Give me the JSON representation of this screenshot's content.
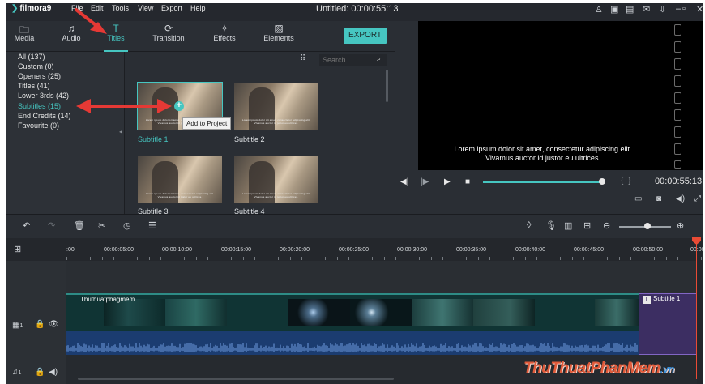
{
  "app": {
    "logo_text": "filmora9",
    "window_title": "Untitled: 00:00:55:13",
    "menu": [
      "File",
      "Edit",
      "Tools",
      "View",
      "Export",
      "Help"
    ],
    "window_icons": [
      "user-icon",
      "save-icon",
      "cart-icon",
      "mail-icon",
      "download-icon",
      "minimize-icon",
      "maximize-icon",
      "close-icon"
    ]
  },
  "tabs": [
    {
      "label": "Media",
      "icon": "folder-icon"
    },
    {
      "label": "Audio",
      "icon": "music-note-icon"
    },
    {
      "label": "Titles",
      "icon": "text-icon"
    },
    {
      "label": "Transition",
      "icon": "transition-icon"
    },
    {
      "label": "Effects",
      "icon": "effects-icon"
    },
    {
      "label": "Elements",
      "icon": "elements-icon"
    }
  ],
  "active_tab": "Titles",
  "export_label": "EXPORT",
  "categories": [
    "All (137)",
    "Custom (0)",
    "Openers (25)",
    "Titles (41)",
    "Lower 3rds (42)",
    "Subtitles (15)",
    "End Credits (14)",
    "Favourite (0)"
  ],
  "active_category": "Subtitles (15)",
  "search": {
    "placeholder": "Search"
  },
  "thumbnails": [
    {
      "label": "Subtitle 1",
      "caption": "Lorem ipsum dolor sit amet, consectetur adipiscing elit. Vivamus auctor id justor eu ultrices."
    },
    {
      "label": "Subtitle 2",
      "caption": "Lorem ipsum dolor sit amet, consectetur adipiscing elit. Vivamus auctor id justor eu ultrices."
    },
    {
      "label": "Subtitle 3",
      "caption": "Lorem ipsum dolor sit amet, consectetur adipiscing elit. Vivamus auctor id justor eu ultrices."
    },
    {
      "label": "Subtitle 4",
      "caption": "Lorem ipsum dolor sit amet, consectetur adipiscing elit. Vivamus auctor id justor eu ultrices."
    }
  ],
  "tooltip": "Add to Project",
  "preview": {
    "caption_line1": "Lorem ipsum dolor sit amet, consectetur adipiscing elit.",
    "caption_line2": "Vivamus auctor id justor eu ultrices.",
    "timecode": "00:00:55:13",
    "progress": 0.98
  },
  "ruler_labels": [
    ":00",
    "00:00:05:00",
    "00:00:10:00",
    "00:00:15:00",
    "00:00:20:00",
    "00:00:25:00",
    "00:00:30:00",
    "00:00:35:00",
    "00:00:40:00",
    "00:00:45:00",
    "00:00:50:00",
    "00:00"
  ],
  "timeline": {
    "video_clip_name": "Thuthuatphagmem",
    "subtitle_clip_label": "Subtitle 1",
    "zoom_level": 0.55
  },
  "track_headers": {
    "video_track_number": "1",
    "audio_track_number": "1"
  },
  "watermark": {
    "main": "ThuThuatPhanMem",
    "suffix": ".vn"
  }
}
